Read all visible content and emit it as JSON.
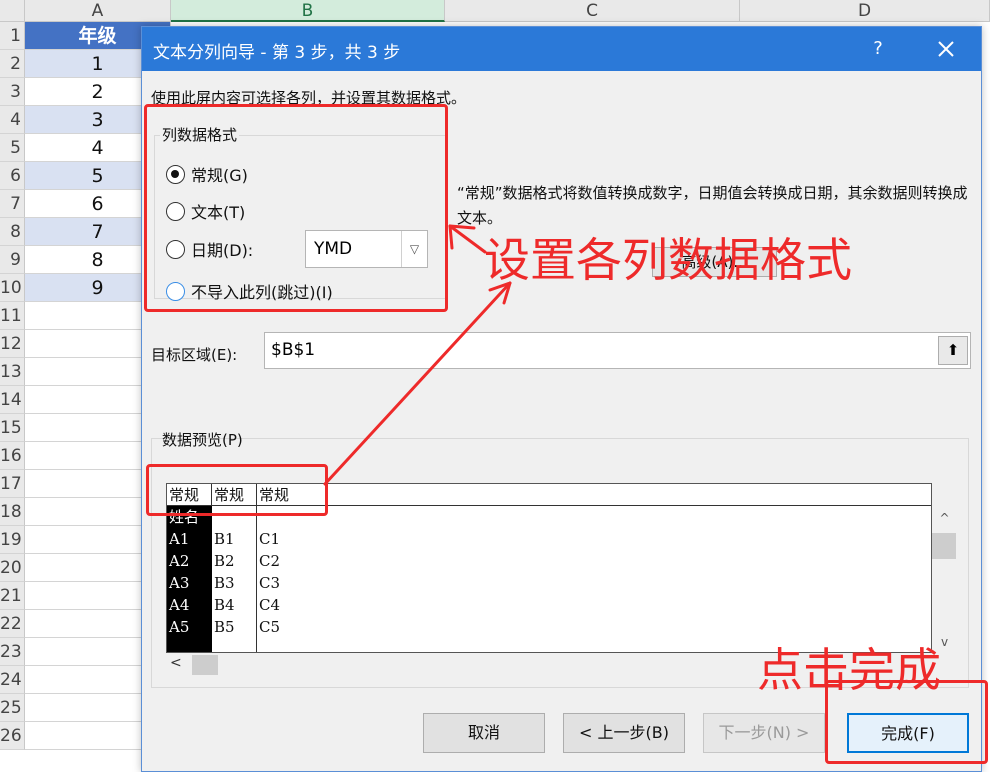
{
  "sheet": {
    "columns": [
      "A",
      "B",
      "C",
      "D"
    ],
    "rows": [
      "1",
      "2",
      "3",
      "4",
      "5",
      "6",
      "7",
      "8",
      "9",
      "10",
      "11",
      "12",
      "13",
      "14",
      "15",
      "16",
      "17",
      "18",
      "19",
      "20",
      "21",
      "22",
      "23",
      "24",
      "25",
      "26"
    ],
    "cells_a": [
      "年级",
      "1",
      "2",
      "3",
      "4",
      "5",
      "6",
      "7",
      "8",
      "9"
    ]
  },
  "dialog": {
    "title": "文本分列向导 - 第 3 步，共 3 步",
    "help": "?",
    "intro": "使用此屏内容可选择各列，并设置其数据格式。",
    "format_group": {
      "label": "列数据格式",
      "options": [
        "常规(G)",
        "文本(T)",
        "日期(D):",
        "不导入此列(跳过)(I)"
      ],
      "selected": "常规(G)",
      "date_value": "YMD"
    },
    "description": "“常规”数据格式将数值转换成数字，日期值会转换成日期，其余数据则转换成文本。",
    "advanced_button": "高级(A)...",
    "destination": {
      "label": "目标区域(E):",
      "value": "$B$1"
    },
    "preview": {
      "label": "数据预览(P)",
      "headers": [
        "常规",
        "常规",
        "常规"
      ],
      "columns": [
        [
          "姓名",
          "A1",
          "A2",
          "A3",
          "A4",
          "A5"
        ],
        [
          "",
          "B1",
          "B2",
          "B3",
          "B4",
          "B5"
        ],
        [
          "",
          "C1",
          "C2",
          "C3",
          "C4",
          "C5"
        ]
      ]
    },
    "buttons": {
      "cancel": "取消",
      "back": "< 上一步(B)",
      "next": "下一步(N) >",
      "finish": "完成(F)"
    }
  },
  "annotations": {
    "format_note": "设置各列数据格式",
    "finish_note": "点击完成",
    "color": "#ee2a2a"
  }
}
